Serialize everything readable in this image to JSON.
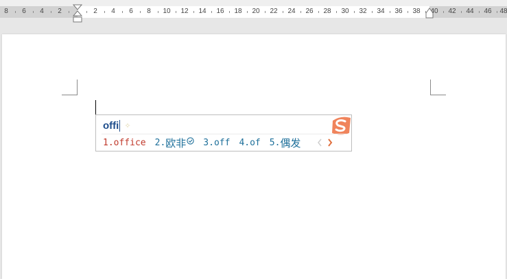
{
  "ruler": {
    "left_labels": [
      "8",
      "6",
      "4",
      "2"
    ],
    "right_labels": [
      "2",
      "4",
      "6",
      "8",
      "10",
      "12",
      "14",
      "16",
      "18",
      "20",
      "22",
      "24",
      "26",
      "28",
      "30",
      "32",
      "34",
      "36",
      "38",
      "40",
      "42",
      "44",
      "46",
      "48"
    ]
  },
  "ime": {
    "composition": "offi",
    "candidates": [
      {
        "index": "1.",
        "text": "office"
      },
      {
        "index": "2.",
        "text": "欧非"
      },
      {
        "index": "3.",
        "text": "off"
      },
      {
        "index": "4.",
        "text": "of"
      },
      {
        "index": "5.",
        "text": "偶发"
      }
    ],
    "nav_prev": "‹",
    "nav_next": "›",
    "colors": {
      "selected": "#c0392b",
      "candidate": "#1d6f9a",
      "logo": "#f0845c"
    }
  }
}
